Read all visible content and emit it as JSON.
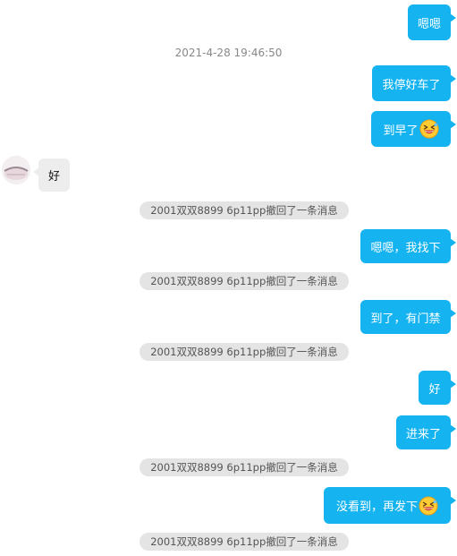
{
  "timestamp": "2021-4-28 19:46:50",
  "messages": {
    "m1": "嗯嗯",
    "m2": "我停好车了",
    "m3": "到早了",
    "m4": "好",
    "m5": "嗯嗯，我找下",
    "m6": "到了，有门禁",
    "m7": "好",
    "m8": "进来了",
    "m9": "没看到，再发下"
  },
  "recall_notice": "2001双双8899 6p11pp撤回了一条消息",
  "colors": {
    "outgoing_bubble": "#15b3f0",
    "incoming_bubble": "#ededed",
    "notice_pill": "#e4e4e4"
  },
  "icons": {
    "laugh_emoji": "grinning-squinting-face-icon"
  }
}
